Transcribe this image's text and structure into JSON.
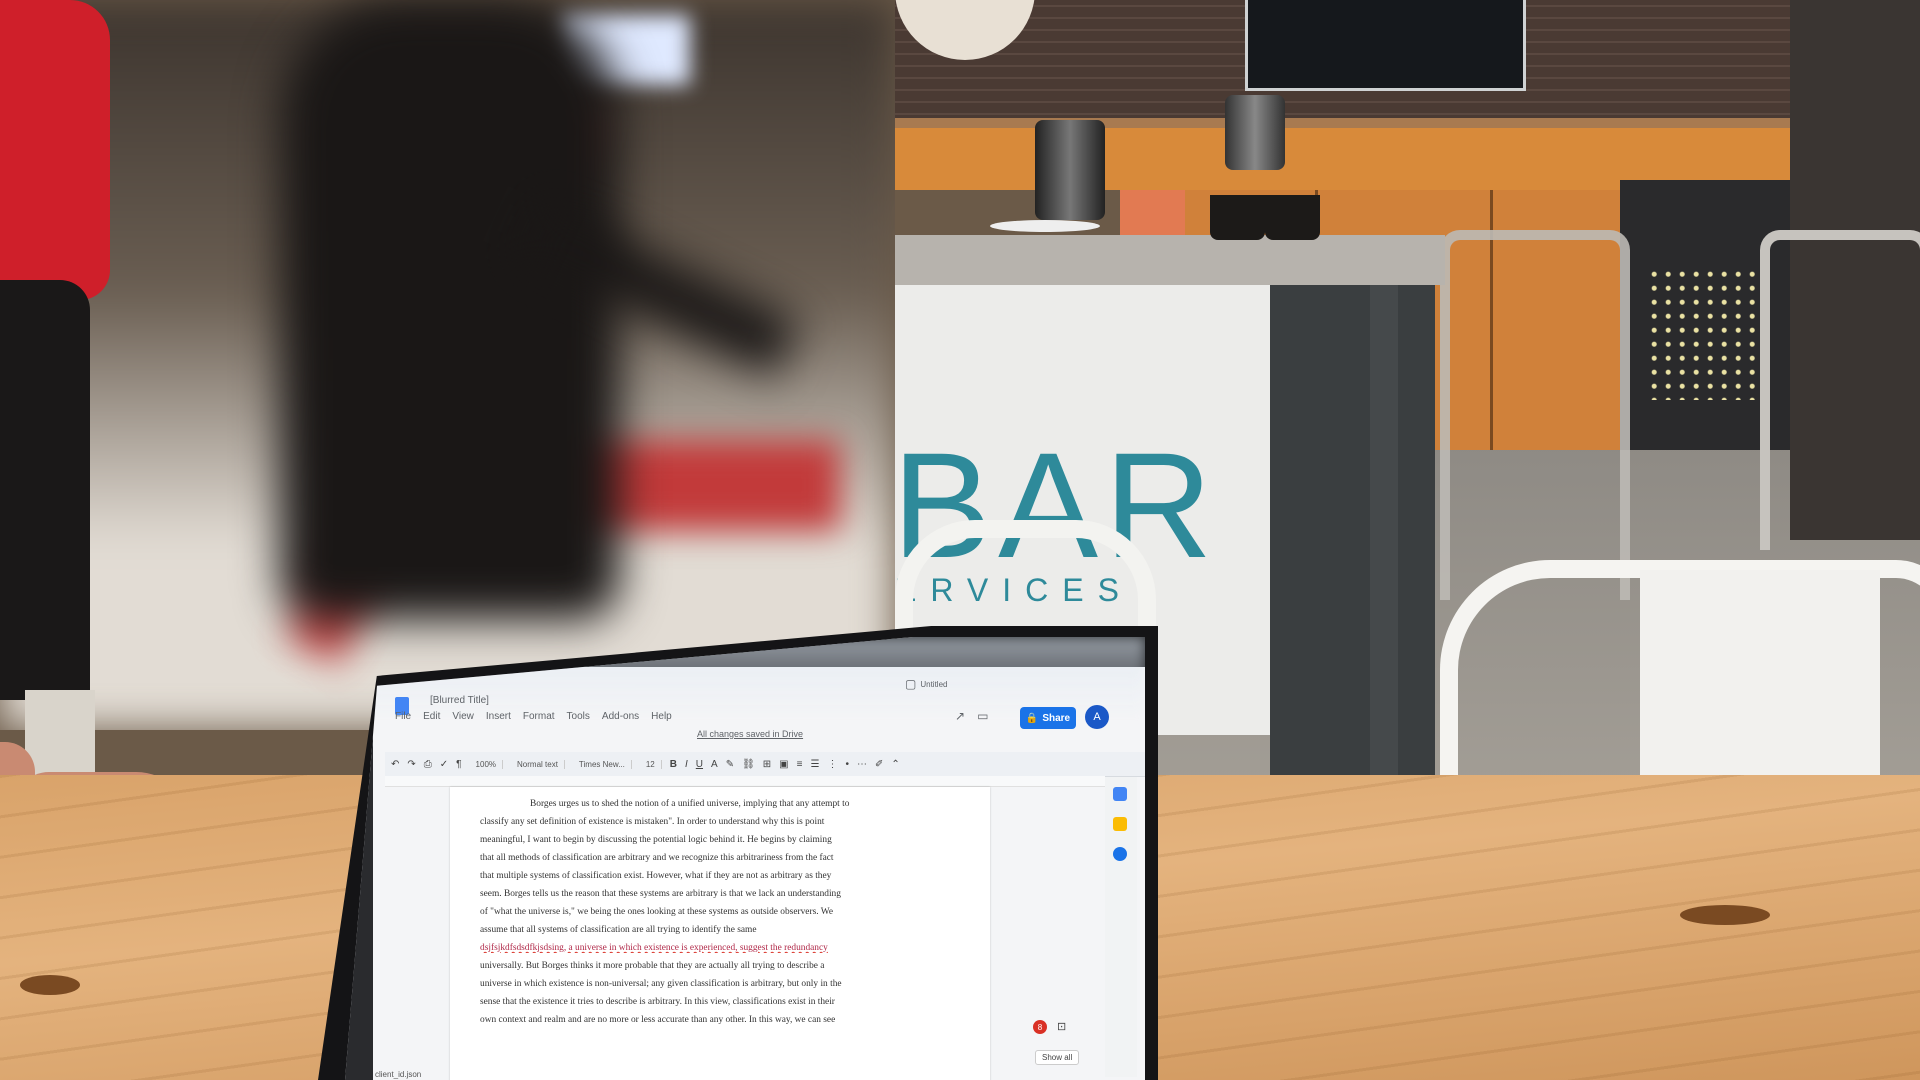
{
  "scene": {
    "signage": {
      "bar_word": "BAR",
      "sub_word": "ERVICES"
    }
  },
  "laptop": {
    "doc": {
      "title": "[Blurred Title]",
      "menu": [
        "File",
        "Edit",
        "View",
        "Insert",
        "Format",
        "Tools",
        "Add-ons",
        "Help"
      ],
      "saved_status": "All changes saved in Drive",
      "toolbar": {
        "zoom": "100%",
        "style": "Normal text",
        "font": "Times New...",
        "size": "12"
      },
      "share_label": "Share",
      "avatar_letter": "A",
      "tab_label": "Untitled",
      "show_all_label": "Show all",
      "status_text": "client_id.json",
      "badge_count": "8",
      "lines": [
        "Borges urges us to shed the notion of a unified universe, implying that any attempt to",
        "classify any set definition of existence is mistaken\". In order to understand why this is point",
        "meaningful, I want to begin by discussing the potential logic behind it. He begins by claiming",
        "that all methods of classification are arbitrary and we recognize this arbitrariness from the fact",
        "that multiple systems of classification exist. However, what if they are not as arbitrary as they",
        "seem. Borges tells us the reason that these systems are arbitrary is that we lack an understanding",
        "of \"what the universe is,\" we being the ones looking at these systems as outside observers. We",
        "assume that all systems of classification are all trying to identify the same",
        "dsjfsjkdfsdsdfkjsdsing, a universe in which existence is experienced, suggest the redundancy",
        "universally. But Borges thinks it more probable that they are actually all trying to describe a",
        "universe in which existence is non-universal; any given classification is arbitrary, but only in the",
        "sense that the existence it tries to describe is arbitrary. In this view, classifications exist in their",
        "own context and realm and are no more or less accurate than any other. In this way, we can see"
      ],
      "misspelled_word": "dsjfsjkdfsdsdfkjsdsing"
    }
  },
  "colors": {
    "signage": "#2e8a9a",
    "share": "#1a73e8",
    "hoodie": "#cf1f2a"
  }
}
